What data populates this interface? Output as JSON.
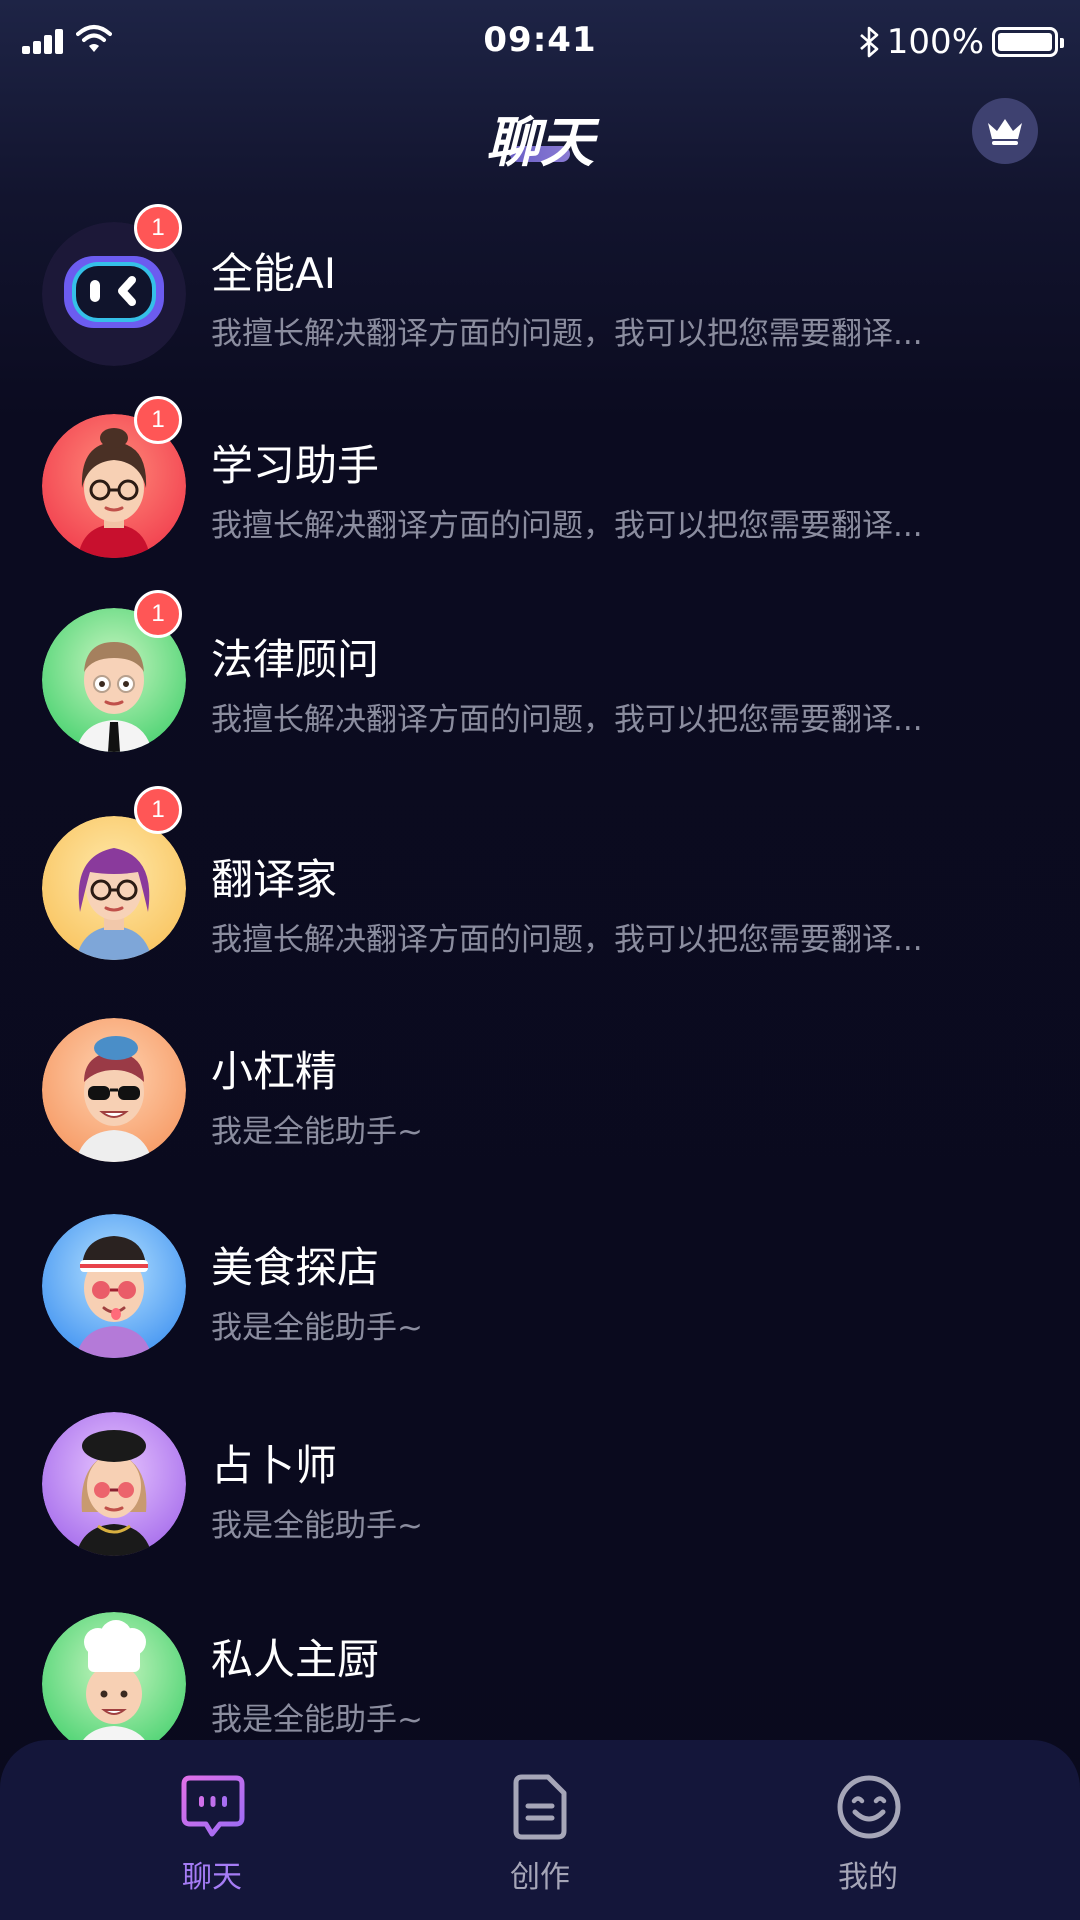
{
  "status_bar": {
    "time": "09:41",
    "battery_text": "100%",
    "battery_level": 1.0,
    "icons": [
      "signal-icon",
      "wifi-icon",
      "bluetooth-icon",
      "battery-icon"
    ]
  },
  "header": {
    "title": "聊天",
    "vip_icon": "crown-icon"
  },
  "colors": {
    "background": "#0a0a1d",
    "badge": "#ff5656",
    "accent": "#a57cf5",
    "tab_bar": "#14163a",
    "muted_text": "#8b8d9f"
  },
  "chats": [
    {
      "name": "全能AI",
      "preview": "我擅长解决翻译方面的问题，我可以把您需要翻译...",
      "unread": "1",
      "avatar": "robot-avatar"
    },
    {
      "name": "学习助手",
      "preview": "我擅长解决翻译方面的问题，我可以把您需要翻译...",
      "unread": "1",
      "avatar": "woman-glasses-avatar"
    },
    {
      "name": "法律顾问",
      "preview": "我擅长解决翻译方面的问题，我可以把您需要翻译...",
      "unread": "1",
      "avatar": "man-suit-avatar"
    },
    {
      "name": "翻译家",
      "preview": "我擅长解决翻译方面的问题，我可以把您需要翻译...",
      "unread": "1",
      "avatar": "purple-hair-avatar"
    },
    {
      "name": "小杠精",
      "preview": "我是全能助手~",
      "unread": "",
      "avatar": "sunglasses-avatar"
    },
    {
      "name": "美食探店",
      "preview": "我是全能助手~",
      "unread": "",
      "avatar": "headband-avatar"
    },
    {
      "name": "占卜师",
      "preview": "我是全能助手~",
      "unread": "",
      "avatar": "fortune-teller-avatar"
    },
    {
      "name": "私人主厨",
      "preview": "我是全能助手~",
      "unread": "",
      "avatar": "chef-avatar"
    }
  ],
  "tabs": [
    {
      "label": "聊天",
      "icon": "chat-bubble-icon",
      "active": true
    },
    {
      "label": "创作",
      "icon": "document-icon",
      "active": false
    },
    {
      "label": "我的",
      "icon": "smiley-icon",
      "active": false
    }
  ]
}
